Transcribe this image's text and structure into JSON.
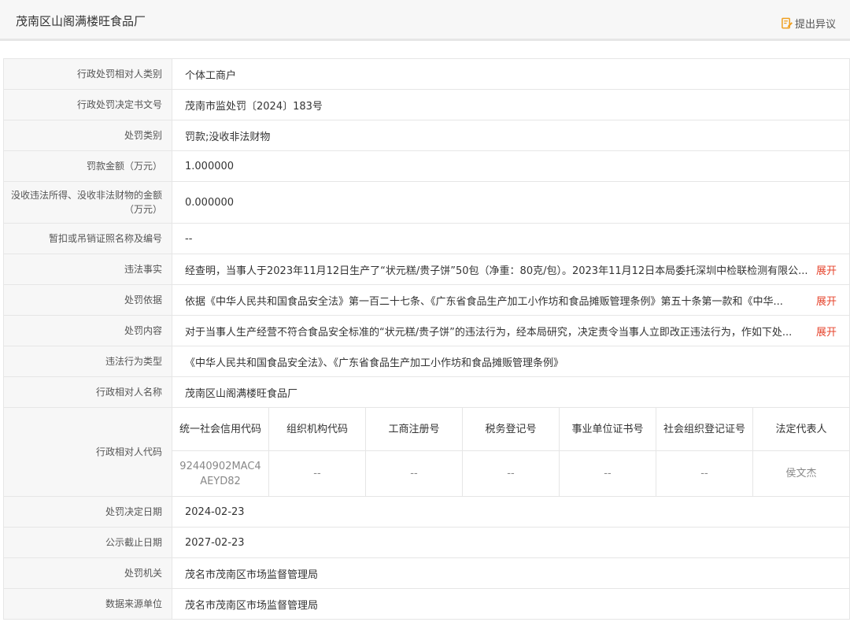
{
  "header": {
    "title": "茂南区山阁满楼旺食品厂",
    "dispute_label": "提出异议",
    "accent_color": "#f0a020"
  },
  "rows": [
    {
      "label": "行政处罚相对人类别",
      "value": "个体工商户"
    },
    {
      "label": "行政处罚决定书文号",
      "value": "茂南市监处罚〔2024〕183号"
    },
    {
      "label": "处罚类别",
      "value": "罚款;没收非法财物"
    },
    {
      "label": "罚款金额（万元）",
      "value": "1.000000"
    },
    {
      "label": "没收违法所得、没收非法财物的金额（万元）",
      "value": "0.000000"
    },
    {
      "label": "暂扣或吊销证照名称及编号",
      "value": "--"
    },
    {
      "label": "违法事实",
      "value": "经查明，当事人于2023年11月12日生产了“状元糕/贵子饼”50包（净重：80克/包）。2023年11月12日本局委托深圳中检联检测有限公...",
      "expand": "展开"
    },
    {
      "label": "处罚依据",
      "value": "依据《中华人民共和国食品安全法》第一百二十七条、《广东省食品生产加工小作坊和食品摊贩管理条例》第五十条第一款和《中华...",
      "expand": "展开"
    },
    {
      "label": "处罚内容",
      "value": "对于当事人生产经营不符合食品安全标准的“状元糕/贵子饼”的违法行为，经本局研究，决定责令当事人立即改正违法行为，作如下处...",
      "expand": "展开"
    },
    {
      "label": "违法行为类型",
      "value": "《中华人民共和国食品安全法》、《广东省食品生产加工小作坊和食品摊贩管理条例》"
    },
    {
      "label": "行政相对人名称",
      "value": "茂南区山阁满楼旺食品厂"
    }
  ],
  "code": {
    "label": "行政相对人代码",
    "headers": [
      "统一社会信用代码",
      "组织机构代码",
      "工商注册号",
      "税务登记号",
      "事业单位证书号",
      "社会组织登记证号",
      "法定代表人"
    ],
    "values": [
      "92440902MAC4AEYD82",
      "--",
      "--",
      "--",
      "--",
      "--",
      "侯文杰"
    ]
  },
  "rows_after": [
    {
      "label": "处罚决定日期",
      "value": "2024-02-23"
    },
    {
      "label": "公示截止日期",
      "value": "2027-02-23"
    },
    {
      "label": "处罚机关",
      "value": "茂名市茂南区市场监督管理局"
    },
    {
      "label": "数据来源单位",
      "value": "茂名市茂南区市场监督管理局"
    }
  ]
}
